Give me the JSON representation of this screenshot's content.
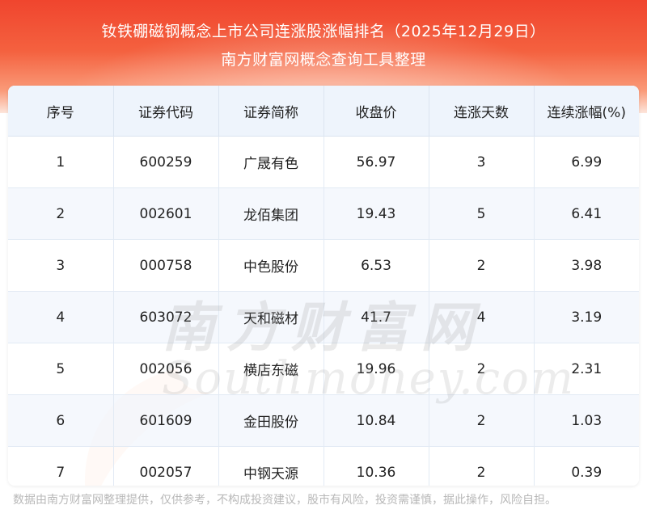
{
  "header": {
    "title_line1": "钕铁硼磁钢概念上市公司连涨股涨幅排名（2025年12月29日）",
    "title_line2": "南方财富网概念查询工具整理"
  },
  "table": {
    "columns": [
      "序号",
      "证券代码",
      "证券简称",
      "收盘价",
      "连涨天数",
      "连续涨幅(%)"
    ],
    "rows": [
      [
        "1",
        "600259",
        "广晟有色",
        "56.97",
        "3",
        "6.99"
      ],
      [
        "2",
        "002601",
        "龙佰集团",
        "19.43",
        "5",
        "6.41"
      ],
      [
        "3",
        "000758",
        "中色股份",
        "6.53",
        "2",
        "3.98"
      ],
      [
        "4",
        "603072",
        "天和磁材",
        "41.7",
        "4",
        "3.19"
      ],
      [
        "5",
        "002056",
        "横店东磁",
        "19.96",
        "2",
        "2.31"
      ],
      [
        "6",
        "601609",
        "金田股份",
        "10.84",
        "2",
        "1.03"
      ],
      [
        "7",
        "002057",
        "中钢天源",
        "10.36",
        "2",
        "0.39"
      ]
    ]
  },
  "watermark": {
    "cn": "南方财富网",
    "en": "Southmoney.com"
  },
  "footer": {
    "disclaimer": "数据由南方财富网整理提供，仅供参考，不构成投资建议，股市有风险，投资需谨慎，据此操作，风险自担。"
  },
  "colors": {
    "header_red": "#f0452e",
    "header_fade": "#fde6dc",
    "table_header_bg": "#eef4fc"
  }
}
